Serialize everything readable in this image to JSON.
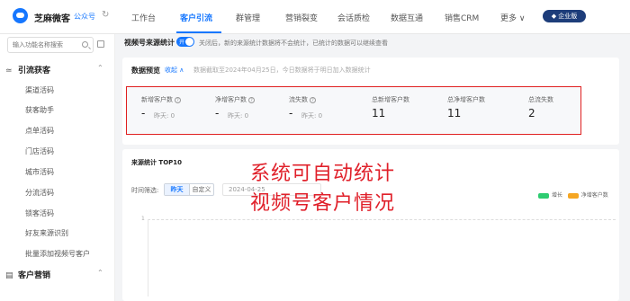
{
  "header": {
    "brand": "芝麻微客",
    "brand_tag": "公众号",
    "nav": [
      "工作台",
      "客户引流",
      "群管理",
      "营销裂变",
      "会话质检",
      "数据互通",
      "销售CRM",
      "更多 ∨"
    ],
    "active_nav": "客户引流",
    "enterprise_badge": "企业版"
  },
  "sidebar": {
    "search_placeholder": "输入功能名称搜索",
    "section1": "引流获客",
    "items": [
      "渠道活码",
      "获客助手",
      "点单活码",
      "门店活码",
      "城市活码",
      "分流活码",
      "锁客活码",
      "好友来源识别",
      "批量添加视频号客户"
    ],
    "section2": "客户营销"
  },
  "main": {
    "title": "视频号来源统计",
    "toggle_label": "开",
    "description": "关闭后，新的来源统计数据将不会统计，已统计的数据可以继续查看",
    "overview": {
      "title": "数据预览",
      "collapse": "收起 ∧",
      "note": "数据截取至2024年04月25日，今日数据将于明日加入数据统计"
    },
    "stats": [
      {
        "label": "新增客户数",
        "value": "-",
        "sub_label": "昨天:",
        "sub_value": "0",
        "help": true
      },
      {
        "label": "净增客户数",
        "value": "-",
        "sub_label": "昨天:",
        "sub_value": "0",
        "help": true
      },
      {
        "label": "流失数",
        "value": "-",
        "sub_label": "昨天:",
        "sub_value": "0",
        "help": true
      },
      {
        "label": "总新增客户数",
        "value": "11",
        "sub_label": "",
        "sub_value": "",
        "help": false
      },
      {
        "label": "总净增客户数",
        "value": "11",
        "sub_label": "",
        "sub_value": "",
        "help": false
      },
      {
        "label": "总流失数",
        "value": "2",
        "sub_label": "",
        "sub_value": "",
        "help": false
      }
    ],
    "source": {
      "title": "来源统计 TOP10",
      "filter_label": "时间筛选:",
      "btn_yesterday": "昨天",
      "btn_custom": "自定义",
      "date": "2024-04-25",
      "legend": [
        {
          "name": "增长",
          "color": "#2ecc71"
        },
        {
          "name": "净增客户数",
          "color": "#f5a623"
        }
      ],
      "axis_tick": "1"
    }
  },
  "overlay": {
    "line1": "系统可自动统计",
    "line2": "视频号客户情况"
  },
  "colors": {
    "accent": "#1677ff",
    "highlight": "#e02020"
  }
}
